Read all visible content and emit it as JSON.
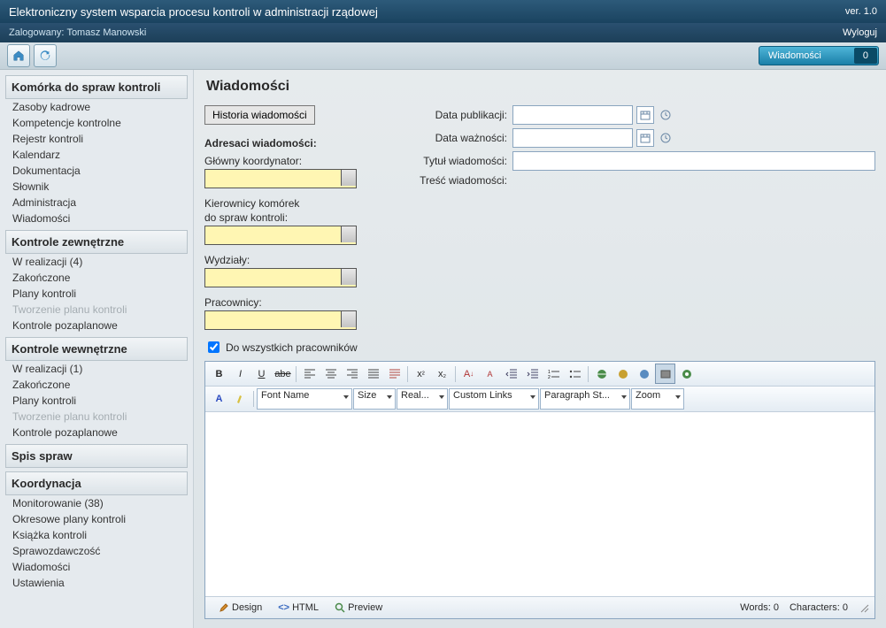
{
  "app_title": "Elektroniczny system wsparcia procesu kontroli w administracji rządowej",
  "version": "ver. 1.0",
  "user_prefix": "Zalogowany:",
  "user_name": "Tomasz Manowski",
  "logout": "Wyloguj",
  "msg_label": "Wiadomości",
  "msg_count": "0",
  "nav": [
    {
      "head": "Komórka do spraw kontroli",
      "items": [
        {
          "t": "Zasoby kadrowe"
        },
        {
          "t": "Kompetencje kontrolne"
        },
        {
          "t": "Rejestr kontroli"
        },
        {
          "t": "Kalendarz"
        },
        {
          "t": "Dokumentacja"
        },
        {
          "t": "Słownik"
        },
        {
          "t": "Administracja"
        },
        {
          "t": "Wiadomości"
        }
      ]
    },
    {
      "head": "Kontrole zewnętrzne",
      "items": [
        {
          "t": "W realizacji (4)"
        },
        {
          "t": "Zakończone"
        },
        {
          "t": "Plany kontroli"
        },
        {
          "t": "Tworzenie planu kontroli",
          "d": true
        },
        {
          "t": "Kontrole pozaplanowe"
        }
      ]
    },
    {
      "head": "Kontrole wewnętrzne",
      "items": [
        {
          "t": "W realizacji (1)"
        },
        {
          "t": "Zakończone"
        },
        {
          "t": "Plany kontroli"
        },
        {
          "t": "Tworzenie planu kontroli",
          "d": true
        },
        {
          "t": "Kontrole pozaplanowe"
        }
      ]
    },
    {
      "head": "Spis spraw",
      "items": []
    },
    {
      "head": "Koordynacja",
      "items": [
        {
          "t": "Monitorowanie (38)"
        },
        {
          "t": "Okresowe plany kontroli"
        },
        {
          "t": "Książka kontroli"
        },
        {
          "t": "Sprawozdawczość"
        },
        {
          "t": "Wiadomości"
        },
        {
          "t": "Ustawienia"
        }
      ]
    }
  ],
  "page_title": "Wiadomości",
  "btn_history": "Historia wiadomości",
  "sec_recipients": "Adresaci wiadomości:",
  "lab_coord": "Główny koordynator:",
  "lab_mgrs1": "Kierownicy komórek",
  "lab_mgrs2": "do spraw kontroli:",
  "lab_dept": "Wydziały:",
  "lab_emp": "Pracownicy:",
  "cb_all": "Do wszystkich pracowników",
  "lab_pubdate": "Data publikacji:",
  "lab_expdate": "Data ważności:",
  "lab_title": "Tytuł wiadomości:",
  "lab_body": "Treść wiadomości:",
  "tb": {
    "font": "Font Name",
    "size": "Size",
    "real": "Real...",
    "links": "Custom Links",
    "para": "Paragraph St...",
    "zoom": "Zoom"
  },
  "foot": {
    "design": "Design",
    "html": "HTML",
    "preview": "Preview",
    "words": "Words: 0",
    "chars": "Characters: 0"
  }
}
